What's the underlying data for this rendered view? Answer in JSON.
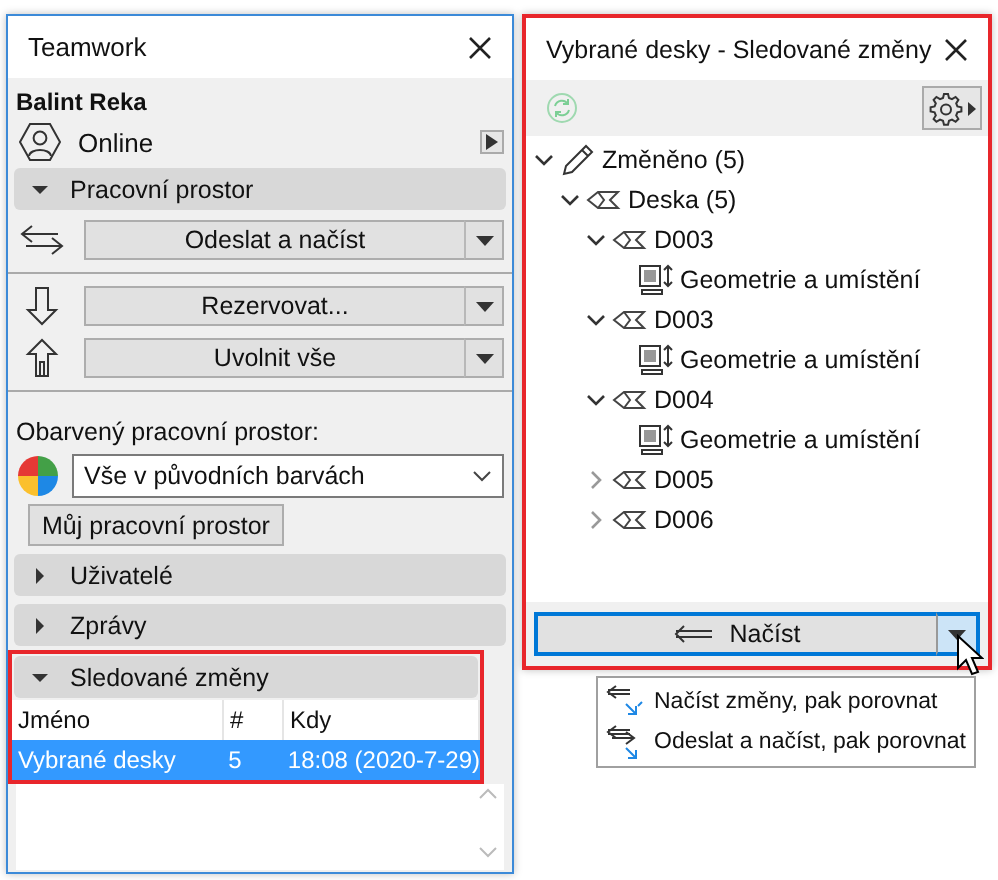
{
  "teamwork": {
    "title": "Teamwork",
    "user": "Balint Reka",
    "status": "Online",
    "workspace_section": {
      "label": "Pracovní prostor",
      "expanded": true
    },
    "send_receive": "Odeslat a načíst",
    "reserve": "Rezervovat...",
    "release": "Uvolnit vše",
    "color_label": "Obarvený pracovní prostor:",
    "color_select": "Vše v původních barvách",
    "my_workspace": "Můj pracovní prostor",
    "sections": [
      {
        "label": "Uživatelé",
        "expanded": false,
        "highlighted": false
      },
      {
        "label": "Zprávy",
        "expanded": false,
        "highlighted": false
      },
      {
        "label": "Sledované změny",
        "expanded": true,
        "highlighted": true
      }
    ],
    "table": {
      "columns": [
        "Jméno",
        "#",
        "Kdy"
      ],
      "rows": [
        {
          "cells": [
            "Vybrané desky",
            "5",
            "18:08 (2020-7-29)"
          ],
          "selected": true
        }
      ]
    }
  },
  "tracked_changes": {
    "title": "Vybrané desky - Sledované změny",
    "highlighted": true,
    "tree": [
      {
        "label": "Změněno (5)",
        "kind": "changed",
        "expanded": true,
        "children": [
          {
            "label": "Deska (5)",
            "kind": "slab",
            "expanded": true,
            "children": [
              {
                "label": "D003",
                "kind": "slab",
                "expanded": true,
                "children": [
                  {
                    "label": "Geometrie a umístění",
                    "kind": "property"
                  }
                ]
              },
              {
                "label": "D003",
                "kind": "slab",
                "expanded": true,
                "children": [
                  {
                    "label": "Geometrie a umístění",
                    "kind": "property"
                  }
                ]
              },
              {
                "label": "D004",
                "kind": "slab",
                "expanded": true,
                "children": [
                  {
                    "label": "Geometrie a umístění",
                    "kind": "property"
                  }
                ]
              },
              {
                "label": "D005",
                "kind": "slab",
                "expanded": false
              },
              {
                "label": "D006",
                "kind": "slab",
                "expanded": false
              }
            ]
          }
        ]
      }
    ],
    "load_button": "Načíst",
    "menu": [
      {
        "label": "Načíst změny, pak porovnat",
        "kind": "receive"
      },
      {
        "label": "Odeslat a načíst, pak porovnat",
        "kind": "send-receive"
      }
    ]
  }
}
